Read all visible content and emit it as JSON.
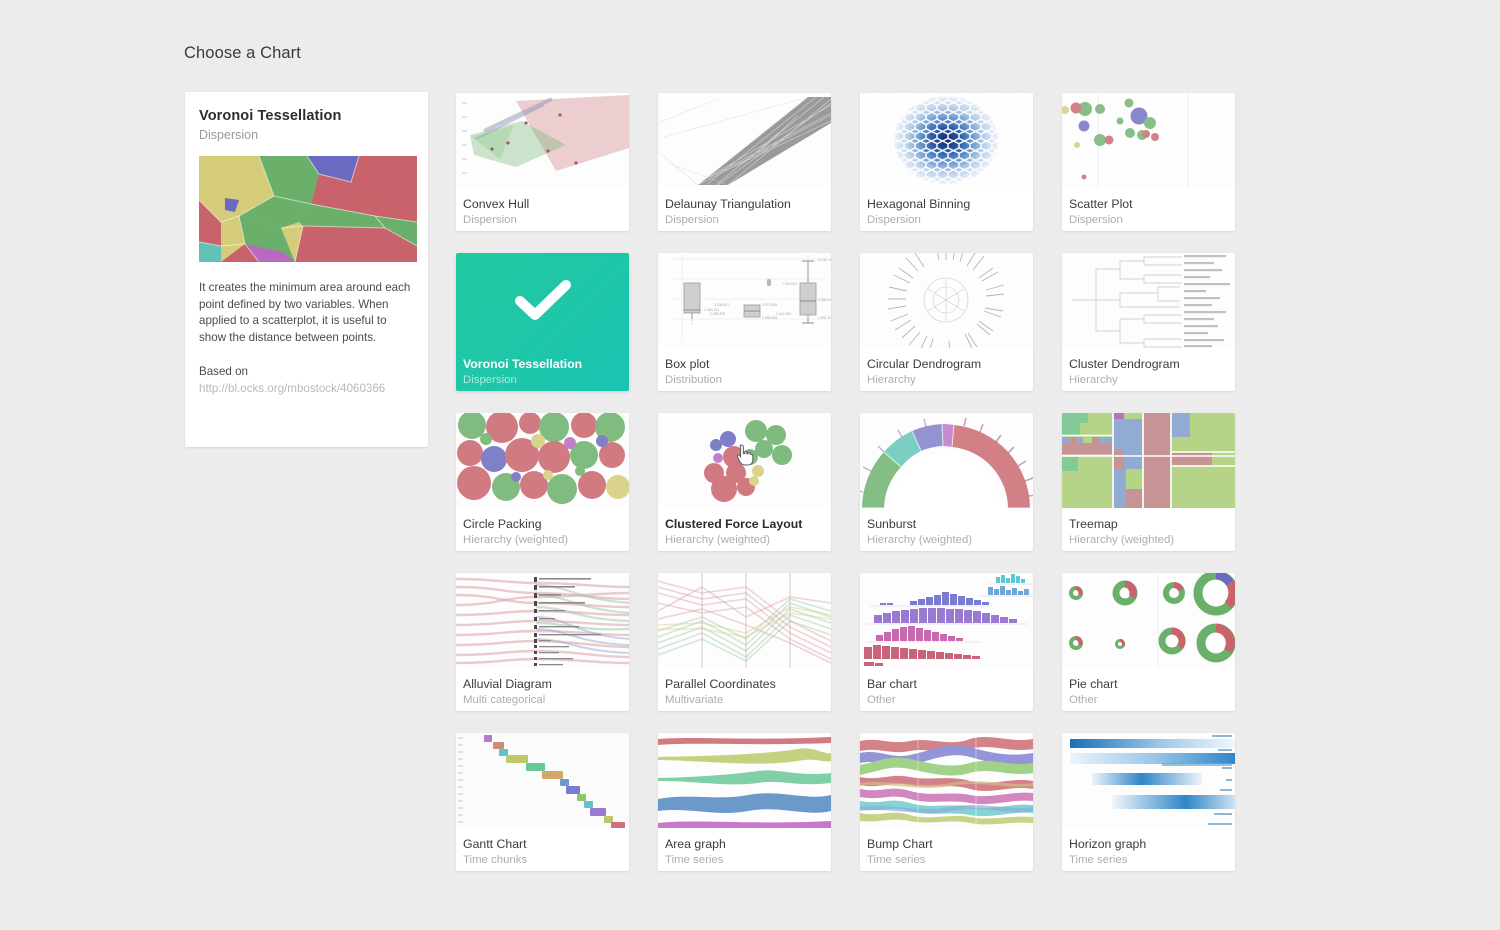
{
  "page": {
    "title": "Choose a Chart",
    "background": "#ececec",
    "accent": "#1fc6a8"
  },
  "detail": {
    "title": "Voronoi Tessellation",
    "category": "Dispersion",
    "description": "It creates the minimum area around each point defined by two variables. When applied to a scatterplot, it is useful to show the distance between points.",
    "based_on_label": "Based on",
    "link": "http://bl.ocks.org/mbostock/4060366",
    "thumbnail_icon": "voronoi-thumbnail"
  },
  "grid": {
    "selected_index": 4,
    "hover_index": 9,
    "cards": [
      {
        "name": "Convex Hull",
        "category": "Dispersion",
        "thumb": "convex-hull-thumbnail"
      },
      {
        "name": "Delaunay Triangulation",
        "category": "Dispersion",
        "thumb": "delaunay-thumbnail"
      },
      {
        "name": "Hexagonal Binning",
        "category": "Dispersion",
        "thumb": "hexbin-thumbnail"
      },
      {
        "name": "Scatter Plot",
        "category": "Dispersion",
        "thumb": "scatter-thumbnail"
      },
      {
        "name": "Voronoi Tessellation",
        "category": "Dispersion",
        "thumb": "check-icon"
      },
      {
        "name": "Box plot",
        "category": "Distribution",
        "thumb": "boxplot-thumbnail"
      },
      {
        "name": "Circular Dendrogram",
        "category": "Hierarchy",
        "thumb": "circular-dendrogram-thumbnail"
      },
      {
        "name": "Cluster Dendrogram",
        "category": "Hierarchy",
        "thumb": "cluster-dendrogram-thumbnail"
      },
      {
        "name": "Circle Packing",
        "category": "Hierarchy (weighted)",
        "thumb": "circle-packing-thumbnail"
      },
      {
        "name": "Clustered Force Layout",
        "category": "Hierarchy (weighted)",
        "thumb": "clustered-force-thumbnail"
      },
      {
        "name": "Sunburst",
        "category": "Hierarchy (weighted)",
        "thumb": "sunburst-thumbnail"
      },
      {
        "name": "Treemap",
        "category": "Hierarchy (weighted)",
        "thumb": "treemap-thumbnail"
      },
      {
        "name": "Alluvial Diagram",
        "category": "Multi categorical",
        "thumb": "alluvial-thumbnail"
      },
      {
        "name": "Parallel Coordinates",
        "category": "Multivariate",
        "thumb": "parallel-coordinates-thumbnail"
      },
      {
        "name": "Bar chart",
        "category": "Other",
        "thumb": "bar-chart-thumbnail"
      },
      {
        "name": "Pie chart",
        "category": "Other",
        "thumb": "pie-chart-thumbnail"
      },
      {
        "name": "Gantt Chart",
        "category": "Time chunks",
        "thumb": "gantt-thumbnail"
      },
      {
        "name": "Area graph",
        "category": "Time series",
        "thumb": "area-graph-thumbnail"
      },
      {
        "name": "Bump Chart",
        "category": "Time series",
        "thumb": "bump-chart-thumbnail"
      },
      {
        "name": "Horizon graph",
        "category": "Time series",
        "thumb": "horizon-graph-thumbnail"
      }
    ]
  },
  "palette": {
    "green": "#6ab06a",
    "red": "#c9636b",
    "blue": "#6a6ac0",
    "yellow": "#d4cc78",
    "purple": "#b96ac0",
    "teal": "#5fc2b5",
    "navy": "#12256b",
    "pink": "#d96aa8"
  }
}
